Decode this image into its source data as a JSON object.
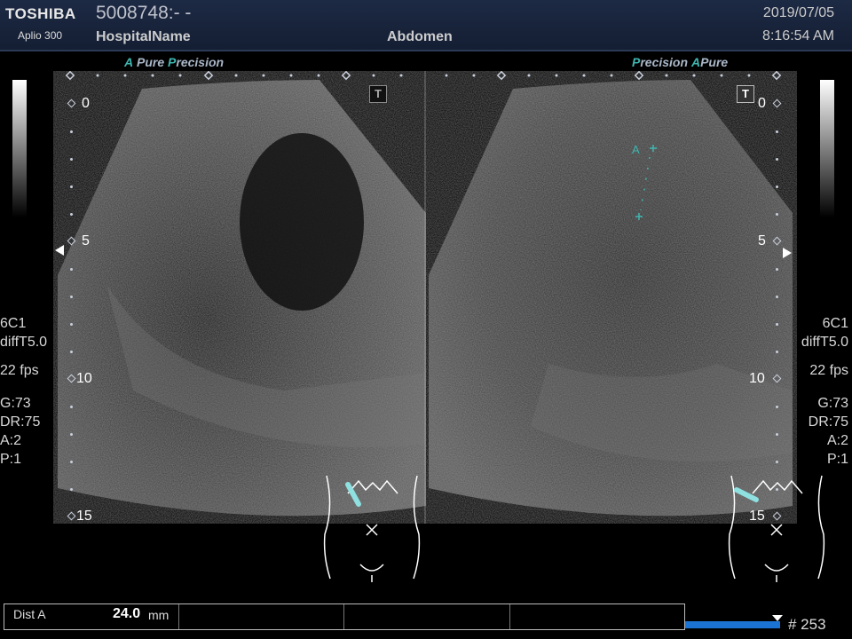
{
  "header": {
    "brand": "TOSHIBA",
    "model": "Aplio 300",
    "patient_id": "5008748:- -",
    "hospital": "HospitalName",
    "study": "Abdomen",
    "date": "2019/07/05",
    "time": "8:16:54 AM"
  },
  "left_mode": {
    "a": "A",
    "pure": "Pure",
    "p": "P",
    "precision": "recision"
  },
  "right_mode": {
    "p": "P",
    "precision": "recision",
    "a": "A",
    "pure": "Pure"
  },
  "left_info": {
    "probe": "6C1",
    "preset": "diffT5.0",
    "fps": "22 fps",
    "gain": "G:73",
    "dr": "DR:75",
    "a": "A:2",
    "p": "P:1"
  },
  "right_info": {
    "probe": "6C1",
    "preset": "diffT5.0",
    "fps": "22 fps",
    "gain": "G:73",
    "dr": "DR:75",
    "a": "A:2",
    "p": "P:1"
  },
  "depth_labels": [
    "0",
    "5",
    "10",
    "15"
  ],
  "t_marker": "T",
  "caliper_label": "A",
  "measurement": {
    "label": "Dist A",
    "value": "24.0",
    "unit": "mm"
  },
  "frame": "# 253",
  "colors": {
    "accent": "#3fb6b0",
    "cine_bar": "#1b74d4",
    "header_bg": "#1d2a44"
  }
}
